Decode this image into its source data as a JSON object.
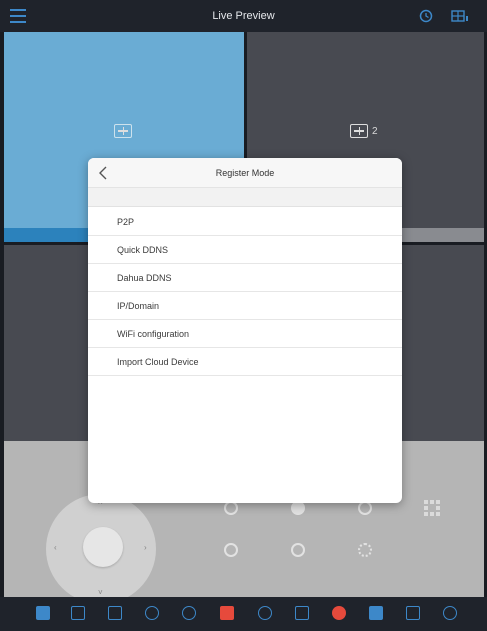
{
  "header": {
    "title": "Live Preview",
    "icons": [
      "menu-icon",
      "playback-icon",
      "multi-screen-icon"
    ]
  },
  "preview": {
    "tiles": [
      {
        "state": "active",
        "channel": ""
      },
      {
        "state": "idle",
        "channel": "2"
      },
      {
        "state": "idle",
        "channel": ""
      },
      {
        "state": "idle",
        "channel": ""
      }
    ]
  },
  "modal": {
    "title": "Register Mode",
    "items": [
      {
        "label": "P2P"
      },
      {
        "label": "Quick DDNS"
      },
      {
        "label": "Dahua DDNS"
      },
      {
        "label": "IP/Domain"
      },
      {
        "label": "WiFi configuration"
      },
      {
        "label": "Import Cloud Device"
      }
    ]
  },
  "ptz": {
    "joystick_arrows": [
      "‹",
      "›",
      "˄",
      "˅"
    ]
  },
  "toolbar": {
    "icons": [
      "channel-icon",
      "snapshot-icon",
      "record-icon",
      "audio-icon",
      "fisheye-icon",
      "video-icon",
      "ptz-icon",
      "alarm-icon",
      "favorite-icon",
      "stream-icon",
      "star-icon",
      "settings-icon"
    ]
  },
  "colors": {
    "bar_bg": "#1f232b",
    "accent": "#3d88c9",
    "active_tile": "#6fb4dd",
    "idle_tile": "#4b4e55",
    "ptz_bg": "#bdbdbd",
    "alert": "#e64a3c"
  }
}
